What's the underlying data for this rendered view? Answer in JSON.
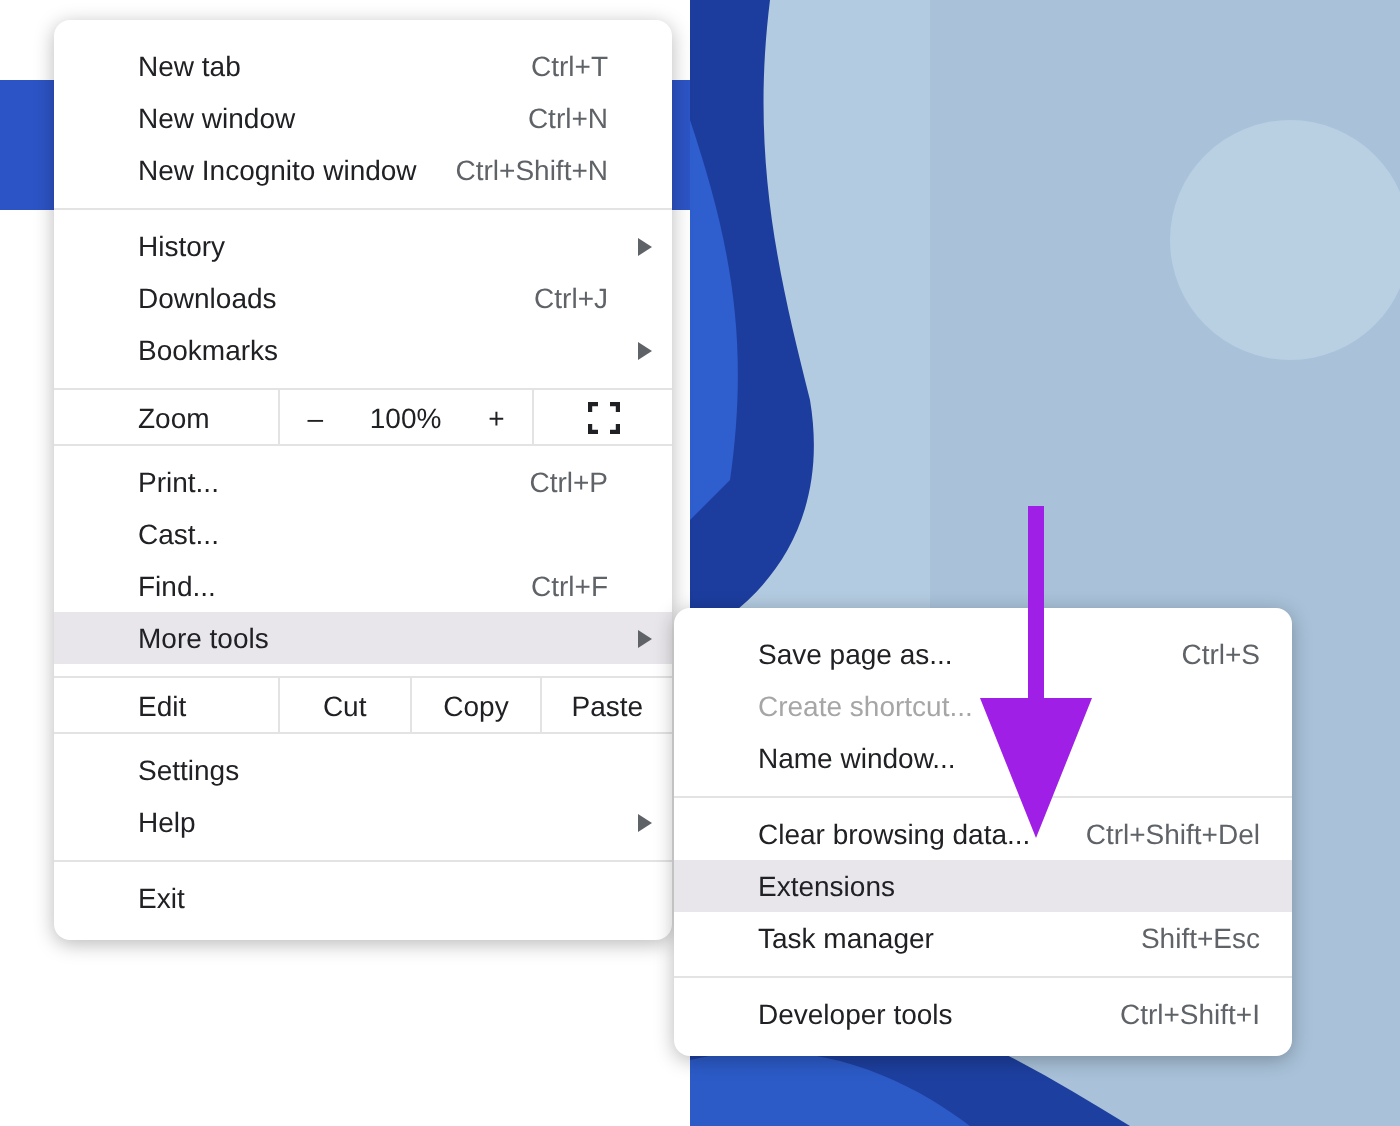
{
  "menu": {
    "items": [
      {
        "kind": "item",
        "label": "New tab",
        "shortcut": "Ctrl+T",
        "submenu": false,
        "selected": false
      },
      {
        "kind": "item",
        "label": "New window",
        "shortcut": "Ctrl+N",
        "submenu": false,
        "selected": false
      },
      {
        "kind": "item",
        "label": "New Incognito window",
        "shortcut": "Ctrl+Shift+N",
        "submenu": false,
        "selected": false
      },
      {
        "kind": "separator"
      },
      {
        "kind": "item",
        "label": "History",
        "submenu": true,
        "selected": false
      },
      {
        "kind": "item",
        "label": "Downloads",
        "shortcut": "Ctrl+J",
        "submenu": false,
        "selected": false
      },
      {
        "kind": "item",
        "label": "Bookmarks",
        "submenu": true,
        "selected": false
      },
      {
        "kind": "zoom",
        "label": "Zoom",
        "minus": "–",
        "value": "100%",
        "plus": "+"
      },
      {
        "kind": "item",
        "label": "Print...",
        "shortcut": "Ctrl+P",
        "submenu": false,
        "selected": false
      },
      {
        "kind": "item",
        "label": "Cast...",
        "submenu": false,
        "selected": false
      },
      {
        "kind": "item",
        "label": "Find...",
        "shortcut": "Ctrl+F",
        "submenu": false,
        "selected": false
      },
      {
        "kind": "item",
        "label": "More tools",
        "submenu": true,
        "selected": true
      },
      {
        "kind": "edit",
        "label": "Edit",
        "actions": [
          "Cut",
          "Copy",
          "Paste"
        ]
      },
      {
        "kind": "item",
        "label": "Settings",
        "submenu": false,
        "selected": false
      },
      {
        "kind": "item",
        "label": "Help",
        "submenu": true,
        "selected": false
      },
      {
        "kind": "separator"
      },
      {
        "kind": "item",
        "label": "Exit",
        "submenu": false,
        "selected": false
      }
    ]
  },
  "submenu": {
    "items": [
      {
        "kind": "item",
        "label": "Save page as...",
        "shortcut": "Ctrl+S",
        "disabled": false,
        "selected": false
      },
      {
        "kind": "item",
        "label": "Create shortcut...",
        "disabled": true,
        "selected": false
      },
      {
        "kind": "item",
        "label": "Name window...",
        "disabled": false,
        "selected": false
      },
      {
        "kind": "separator"
      },
      {
        "kind": "item",
        "label": "Clear browsing data...",
        "shortcut": "Ctrl+Shift+Del",
        "disabled": false,
        "selected": false
      },
      {
        "kind": "item",
        "label": "Extensions",
        "disabled": false,
        "selected": true
      },
      {
        "kind": "item",
        "label": "Task manager",
        "shortcut": "Shift+Esc",
        "disabled": false,
        "selected": false
      },
      {
        "kind": "separator"
      },
      {
        "kind": "item",
        "label": "Developer tools",
        "shortcut": "Ctrl+Shift+I",
        "disabled": false,
        "selected": false
      }
    ]
  }
}
